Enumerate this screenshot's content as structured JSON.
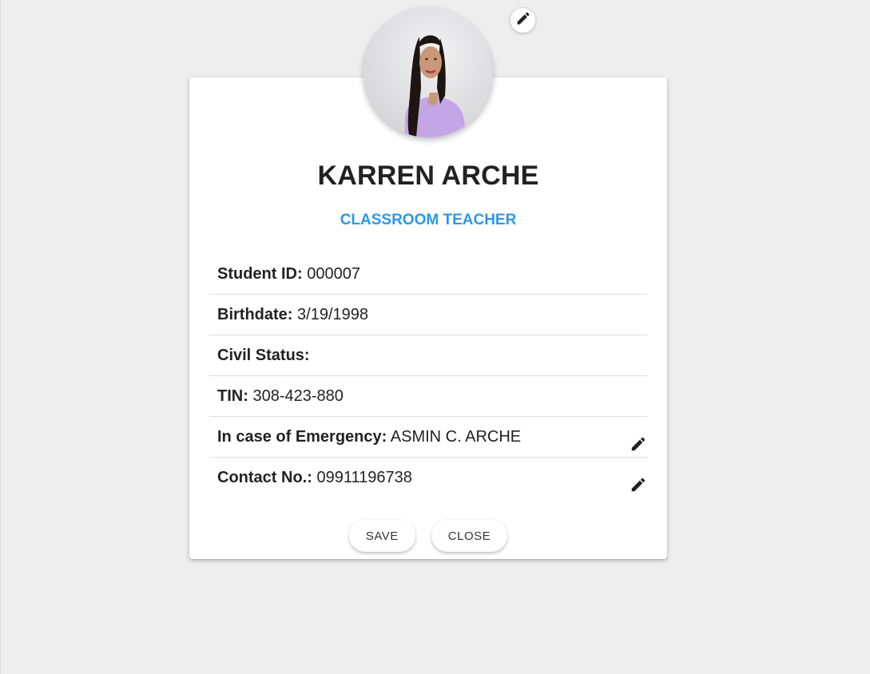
{
  "profile": {
    "name": "KARREN ARCHE",
    "role": "CLASSROOM TEACHER"
  },
  "fields": [
    {
      "label": "Student ID:",
      "value": "000007"
    },
    {
      "label": "Birthdate:",
      "value": "3/19/1998"
    },
    {
      "label": "Civil Status:",
      "value": ""
    },
    {
      "label": "TIN:",
      "value": "308-423-880"
    },
    {
      "label": "In case of Emergency:",
      "value": "ASMIN C. ARCHE"
    },
    {
      "label": "Contact No.:",
      "value": "09911196738"
    }
  ],
  "buttons": {
    "save": "SAVE",
    "close": "CLOSE"
  },
  "icons": {
    "edit": "pencil-icon"
  },
  "colors": {
    "background": "#eeeeee",
    "card": "#ffffff",
    "role": "#2d97e8",
    "text": "#222222"
  }
}
